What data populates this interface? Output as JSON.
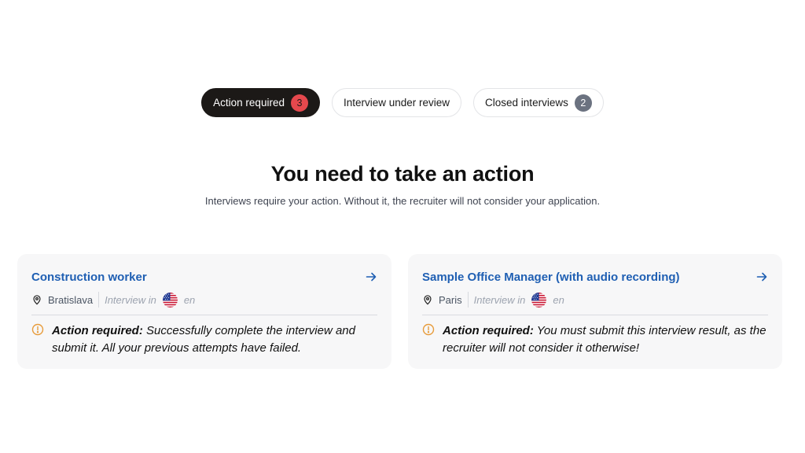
{
  "tabs": [
    {
      "label": "Action required",
      "count": "3",
      "active": true
    },
    {
      "label": "Interview under review",
      "count": null,
      "active": false
    },
    {
      "label": "Closed interviews",
      "count": "2",
      "active": false
    }
  ],
  "heading": "You need to take an action",
  "subheading": "Interviews require your action. Without it, the recruiter will not consider your application.",
  "cards": [
    {
      "title": "Construction worker",
      "city": "Bratislava",
      "interview_in": "Interview in",
      "language": "en",
      "flag_icon": "us-flag-icon",
      "alert_label": "Action required:",
      "alert_text": " Successfully complete the interview and submit it. All your previous attempts have failed."
    },
    {
      "title": "Sample Office Manager (with audio recording)",
      "city": "Paris",
      "interview_in": "Interview in",
      "language": "en",
      "flag_icon": "us-flag-icon",
      "alert_label": "Action required:",
      "alert_text": " You must submit this interview result, as the recruiter will not consider it otherwise!"
    }
  ],
  "colors": {
    "active_tab_bg": "#1c1917",
    "action_badge": "#e5484d",
    "closed_badge": "#6b7280",
    "link": "#1f5fb3",
    "warning": "#e79c3c",
    "card_bg": "#f7f7f8"
  }
}
